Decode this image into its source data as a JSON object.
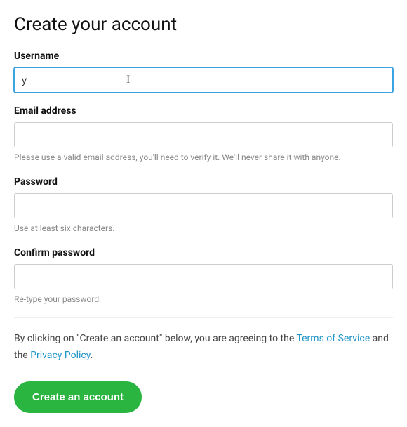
{
  "title": "Create your account",
  "fields": {
    "username": {
      "label": "Username",
      "value": "y"
    },
    "email": {
      "label": "Email address",
      "value": "",
      "help": "Please use a valid email address, you'll need to verify it. We'll never share it with anyone."
    },
    "password": {
      "label": "Password",
      "value": "",
      "help": "Use at least six characters."
    },
    "confirm": {
      "label": "Confirm password",
      "value": "",
      "help": "Re-type your password."
    }
  },
  "agreement": {
    "prefix": "By clicking on \"Create an account\" below, you are agreeing to the ",
    "tos_label": "Terms of Service",
    "middle": " and the ",
    "privacy_label": "Privacy Policy",
    "suffix": "."
  },
  "submit_label": "Create an account"
}
